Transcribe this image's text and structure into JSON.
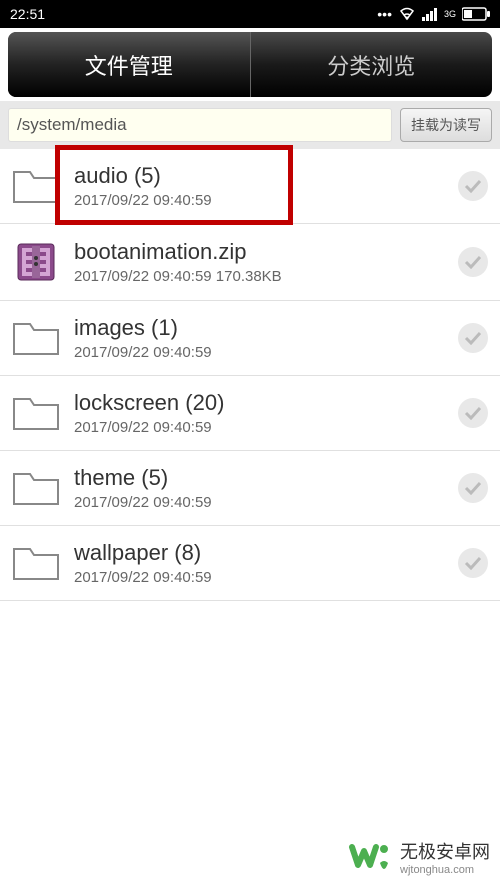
{
  "statusBar": {
    "time": "22:51",
    "network": "3G"
  },
  "tabs": {
    "fileManager": "文件管理",
    "categoryBrowse": "分类浏览"
  },
  "pathBar": {
    "path": "/system/media",
    "mountButton": "挂载为读写"
  },
  "files": [
    {
      "type": "folder",
      "name": "audio  (5)",
      "date": "2017/09/22 09:40:59",
      "size": ""
    },
    {
      "type": "zip",
      "name": "bootanimation.zip",
      "date": "2017/09/22 09:40:59",
      "size": "170.38KB"
    },
    {
      "type": "folder",
      "name": "images  (1)",
      "date": "2017/09/22 09:40:59",
      "size": ""
    },
    {
      "type": "folder",
      "name": "lockscreen  (20)",
      "date": "2017/09/22 09:40:59",
      "size": ""
    },
    {
      "type": "folder",
      "name": "theme  (5)",
      "date": "2017/09/22 09:40:59",
      "size": ""
    },
    {
      "type": "folder",
      "name": "wallpaper  (8)",
      "date": "2017/09/22 09:40:59",
      "size": ""
    }
  ],
  "watermark": {
    "title": "无极安卓网",
    "url": "wjtonghua.com"
  }
}
